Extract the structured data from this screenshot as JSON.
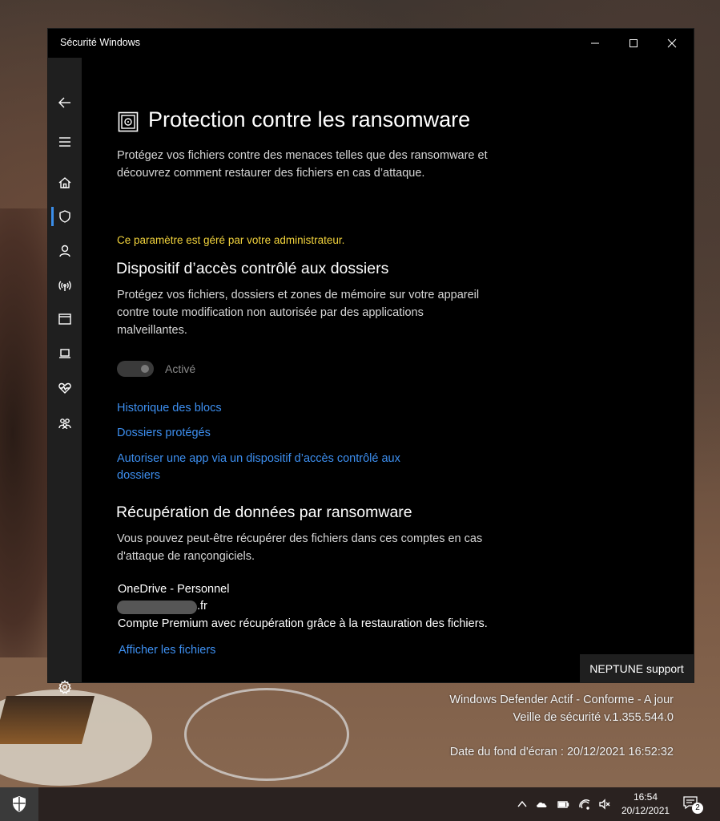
{
  "window": {
    "title": "Sécurité Windows",
    "controls": {
      "minimize": "—",
      "maximize": "☐",
      "close": "✕"
    }
  },
  "nav": {
    "items": [
      {
        "icon": "back-arrow-icon"
      },
      {
        "icon": "hamburger-menu-icon"
      },
      {
        "icon": "home-icon"
      },
      {
        "icon": "shield-icon",
        "active": true
      },
      {
        "icon": "account-icon"
      },
      {
        "icon": "network-icon"
      },
      {
        "icon": "app-browser-icon"
      },
      {
        "icon": "laptop-icon"
      },
      {
        "icon": "heart-health-icon"
      },
      {
        "icon": "family-icon"
      }
    ],
    "settings_icon": "gear-icon"
  },
  "page": {
    "title": "Protection contre les ransomware",
    "intro_line1": "Protégez vos fichiers contre des menaces telles que des ransomware et",
    "intro_line2": "découvrez comment restaurer des fichiers en cas d’attaque.",
    "admin_note": "Ce paramètre est géré par votre administrateur.",
    "cfa": {
      "title": "Dispositif d’accès contrôlé aux dossiers",
      "desc_line1": "Protégez vos fichiers, dossiers et zones de mémoire sur votre appareil",
      "desc_line2": "contre toute modification non autorisée par des applications",
      "desc_line3": "malveillantes.",
      "toggle_label": "Activé",
      "toggle_on": true,
      "links": {
        "history": "Historique des blocs",
        "protected_folders": "Dossiers protégés",
        "allow_app_line1": "Autoriser une app via un dispositif d’accès contrôlé aux",
        "allow_app_line2": "dossiers"
      }
    },
    "recovery": {
      "title": "Récupération de données par ransomware",
      "desc_line1": "Vous pouvez peut-être récupérer des fichiers dans ces comptes en cas",
      "desc_line2": "d'attaque de rançongiciels.",
      "account_name": "OneDrive - Personnel",
      "account_email_suffix": ".fr",
      "account_desc": "Compte Premium avec récupération grâce à la restauration des fichiers.",
      "view_files": "Afficher les fichiers"
    }
  },
  "support_badge": "NEPTUNE support",
  "desktop_overlay": {
    "line1": "Windows Defender Actif - Conforme - A jour",
    "line2": "Veille de sécurité v.1.355.544.0",
    "line3": "Date du fond d'écran : 20/12/2021 16:52:32"
  },
  "taskbar": {
    "time": "16:54",
    "date": "20/12/2021",
    "notifications": "2"
  },
  "colors": {
    "accent": "#3d8ff0",
    "admin_note": "#f2d33c",
    "nav_bg": "#1f1f1f"
  }
}
